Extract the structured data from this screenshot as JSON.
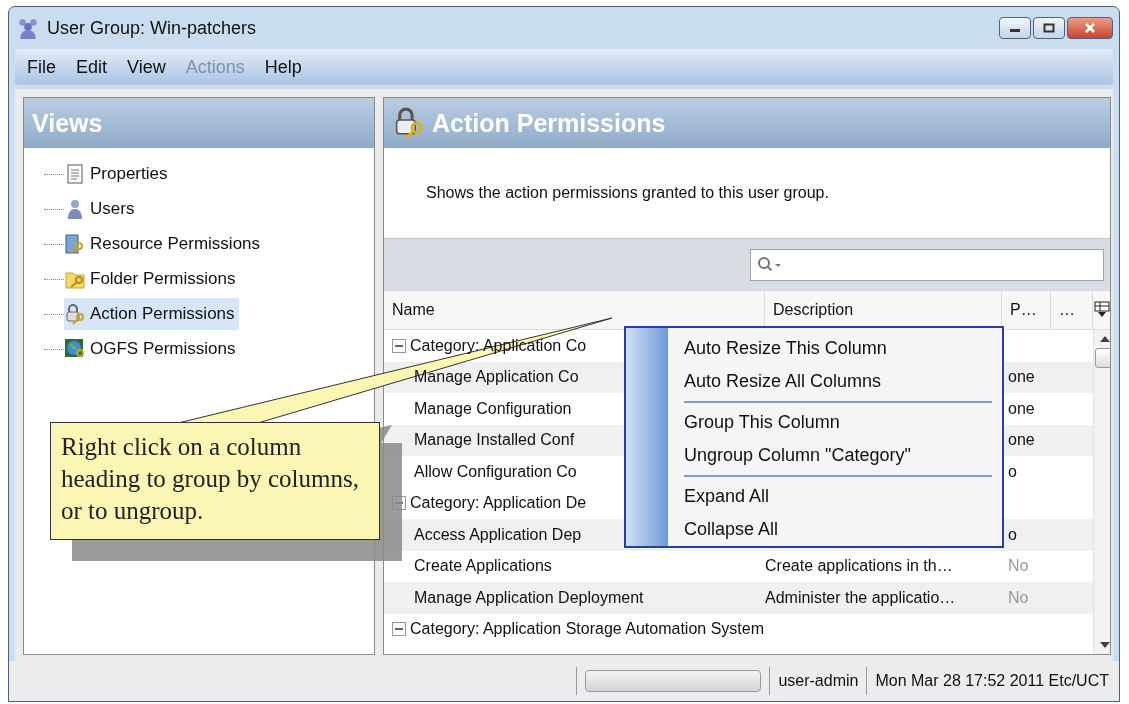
{
  "window": {
    "title": "User Group: Win-patchers"
  },
  "menu_bar": [
    {
      "label": "File",
      "disabled": false
    },
    {
      "label": "Edit",
      "disabled": false
    },
    {
      "label": "View",
      "disabled": false
    },
    {
      "label": "Actions",
      "disabled": true
    },
    {
      "label": "Help",
      "disabled": false
    }
  ],
  "views_panel": {
    "title": "Views",
    "items": [
      {
        "label": "Properties",
        "kind": "document",
        "selected": false
      },
      {
        "label": "Users",
        "kind": "user",
        "selected": false
      },
      {
        "label": "Resource Permissions",
        "kind": "server",
        "selected": false
      },
      {
        "label": "Folder Permissions",
        "kind": "folder",
        "selected": false
      },
      {
        "label": "Action Permissions",
        "kind": "lock",
        "selected": true
      },
      {
        "label": "OGFS Permissions",
        "kind": "globe",
        "selected": false
      }
    ]
  },
  "content": {
    "title": "Action Permissions",
    "description": "Shows the action permissions granted to this user group."
  },
  "table": {
    "columns": [
      "Name",
      "Description",
      "P…",
      "…"
    ],
    "groups": [
      {
        "label": "Category: Application Co",
        "expanded": true,
        "rows": [
          {
            "name": "Manage Application Co",
            "description": "",
            "column_3": "one"
          },
          {
            "name": "Manage Configuration",
            "description": "",
            "column_3": "one"
          },
          {
            "name": "Manage Installed Conf",
            "description": "",
            "column_3": "one"
          },
          {
            "name": "Allow Configuration Co",
            "description": "",
            "column_3": "o"
          }
        ]
      },
      {
        "label": "Category: Application De",
        "expanded": true,
        "rows": [
          {
            "name": "Access Application Dep",
            "description": "",
            "column_3": "o"
          },
          {
            "name": "Create Applications",
            "description": "Create applications in th…",
            "column_3": "No"
          },
          {
            "name": "Manage Application Deployment",
            "description": "Administer the applicatio…",
            "column_3": "No"
          }
        ]
      },
      {
        "label": "Category: Application Storage Automation System",
        "expanded": true
      }
    ]
  },
  "context_menu": {
    "items": [
      {
        "kind": "item",
        "label": "Auto Resize This Column"
      },
      {
        "kind": "item",
        "label": "Auto Resize All Columns"
      },
      {
        "kind": "separator"
      },
      {
        "kind": "item",
        "label": "Group This Column"
      },
      {
        "kind": "item",
        "label": "Ungroup Column \"Category\""
      },
      {
        "kind": "separator"
      },
      {
        "kind": "item",
        "label": "Expand All"
      },
      {
        "kind": "item",
        "label": "Collapse All"
      }
    ]
  },
  "callout": {
    "text": "Right click on a column heading to group by columns, or to ungroup."
  },
  "status_bar": {
    "progress": {
      "level": 0
    },
    "user": "user-admin",
    "timestamp": "Mon Mar 28 17:52 2011 Etc/UCT"
  }
}
